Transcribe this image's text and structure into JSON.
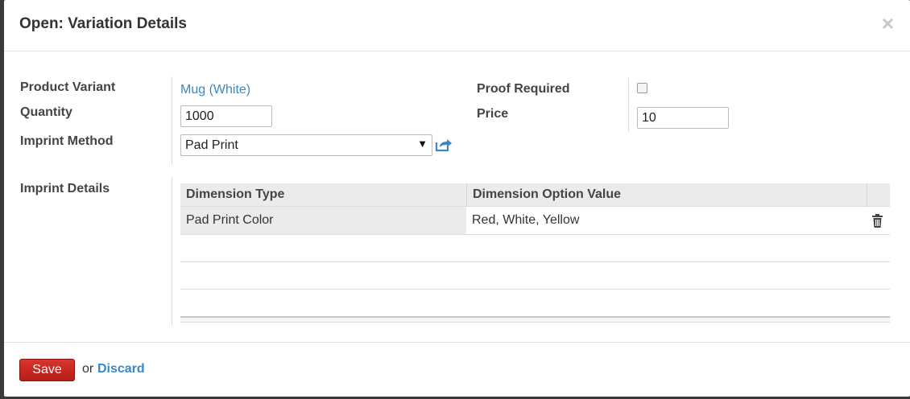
{
  "modal": {
    "title": "Open: Variation Details",
    "close_label": "×"
  },
  "form": {
    "product_variant_label": "Product Variant",
    "product_variant_value": "Mug (White)",
    "quantity_label": "Quantity",
    "quantity_value": "1000",
    "imprint_method_label": "Imprint Method",
    "imprint_method_value": "Pad Print",
    "proof_required_label": "Proof Required",
    "proof_required_checked": false,
    "price_label": "Price",
    "price_value": "10",
    "imprint_details_label": "Imprint Details"
  },
  "grid": {
    "columns": [
      "Dimension Type",
      "Dimension Option Value"
    ],
    "rows": [
      {
        "type": "Pad Print Color",
        "value": "Red, White, Yellow"
      }
    ]
  },
  "footer": {
    "save_label": "Save",
    "or_text": "or",
    "discard_label": "Discard"
  },
  "colors": {
    "link": "#3a87c7",
    "save_button": "#c9271f"
  }
}
